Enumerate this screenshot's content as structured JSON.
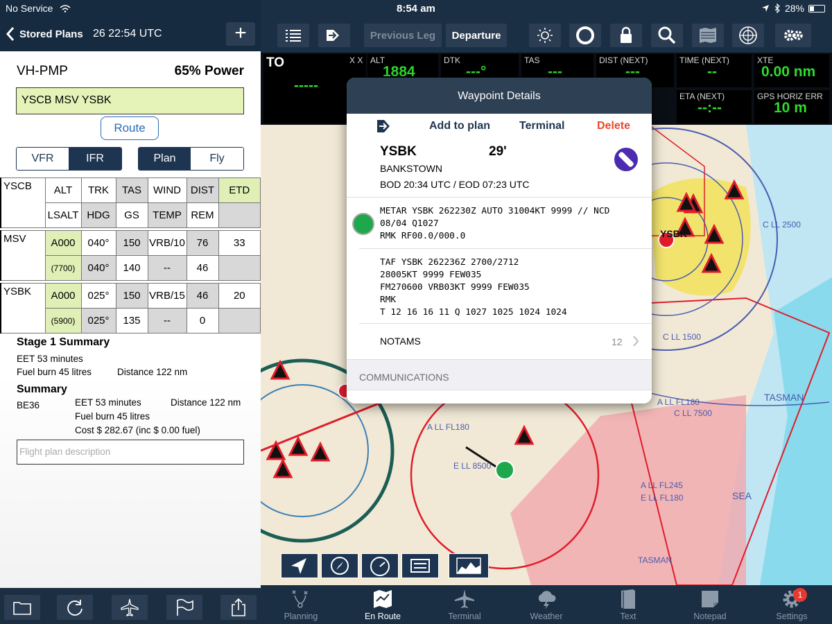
{
  "left_status": {
    "carrier": "No Service"
  },
  "left_nav": {
    "back_label": "Stored Plans",
    "time": "26 22:54 UTC"
  },
  "plan": {
    "aircraft": "VH-PMP",
    "power": "65% Power",
    "route": "YSCB MSV YSBK",
    "route_button": "Route",
    "rules": [
      "VFR",
      "IFR"
    ],
    "rules_selected": "IFR",
    "modes": [
      "Plan",
      "Fly"
    ],
    "mode_selected": "Plan",
    "header_row1": [
      "ALT",
      "TRK",
      "TAS",
      "WIND",
      "DIST",
      "ETD"
    ],
    "header_row2": [
      "LSALT",
      "HDG",
      "GS",
      "TEMP",
      "REM",
      ""
    ],
    "origin": "YSCB",
    "legs": [
      {
        "name": "MSV",
        "alt": "A000",
        "trk": "040°",
        "tas": "150",
        "wind": "VRB/10",
        "dist": "76",
        "etd": "33",
        "lsalt": "(7700)",
        "hdg": "040°",
        "gs": "140",
        "temp": "--",
        "rem": "46"
      },
      {
        "name": "YSBK",
        "alt": "A000",
        "trk": "025°",
        "tas": "150",
        "wind": "VRB/15",
        "dist": "46",
        "etd": "20",
        "lsalt": "(5900)",
        "hdg": "025°",
        "gs": "135",
        "temp": "--",
        "rem": "0"
      }
    ],
    "stage_title": "Stage 1 Summary",
    "stage_eet": "EET 53 minutes",
    "stage_fuel": "Fuel burn 45 litres",
    "stage_distance": "Distance 122 nm",
    "summary_title": "Summary",
    "summary_type": "BE36",
    "summary_eet": "EET 53 minutes",
    "summary_distance": "Distance 122 nm",
    "summary_fuel": "Fuel burn 45 litres",
    "summary_cost": "Cost $ 282.67 (inc $ 0.00 fuel)",
    "description_placeholder": "Flight plan description"
  },
  "top_status": {
    "time": "8:54 am",
    "battery": "28%"
  },
  "toolbar": {
    "previous_leg": "Previous Leg",
    "departure": "Departure"
  },
  "instruments": {
    "to_label": "TO",
    "to_xx": "X X",
    "to_value": "-----",
    "alt_label": "ALT",
    "alt_value": "1884",
    "dtk_label": "DTK",
    "dtk_value": "---°",
    "tas_label": "TAS",
    "tas_value": "---",
    "dist_label": "DIST (NEXT)",
    "dist_value": "---",
    "time_label": "TIME (NEXT)",
    "time_value": "--",
    "xte_label": "XTE",
    "xte_value": "0.00 nm",
    "eta_label": "ETA (NEXT)",
    "eta_value": "--:--",
    "gps_label": "GPS HORIZ ERR",
    "gps_value": "10 m"
  },
  "waypoint": {
    "header": "Waypoint Details",
    "add_to_plan": "Add to plan",
    "terminal": "Terminal",
    "delete": "Delete",
    "id": "YSBK",
    "elevation": "29'",
    "name": "BANKSTOWN",
    "bod_eod": "BOD 20:34 UTC / EOD 07:23 UTC",
    "metar": "METAR YSBK 262230Z AUTO 31004KT 9999 // NCD\n08/04 Q1027\nRMK RF00.0/000.0",
    "taf": "TAF YSBK 262236Z 2700/2712\n28005KT 9999 FEW035\nFM270600 VRB03KT 9999 FEW035\nRMK\nT 12 16 16 11 Q 1027 1025 1024 1024",
    "notams_label": "NOTAMS",
    "notams_count": "12",
    "communications": "COMMUNICATIONS"
  },
  "map": {
    "labels": [
      "YSBK",
      "TASMAN",
      "SEA",
      "A LL FL180",
      "E LL 8500",
      "A LL FL245",
      "E LL FL180",
      "TASMAN",
      "A LL FL180",
      "C LL 7500",
      "C LL 2500",
      "C LL 1500"
    ]
  },
  "tabs": [
    {
      "label": "Planning",
      "icon": "planning-icon"
    },
    {
      "label": "En Route",
      "icon": "map-icon"
    },
    {
      "label": "Terminal",
      "icon": "plane-icon"
    },
    {
      "label": "Weather",
      "icon": "weather-icon"
    },
    {
      "label": "Text",
      "icon": "book-icon"
    },
    {
      "label": "Notepad",
      "icon": "notepad-icon"
    },
    {
      "label": "Settings",
      "icon": "gear-icon"
    }
  ],
  "settings_badge": "1",
  "colors": {
    "nav_dark": "#1a2e44",
    "instrument_green": "#2ddd2d",
    "delete_red": "#e8482f",
    "route_green": "#e6f3b8"
  }
}
